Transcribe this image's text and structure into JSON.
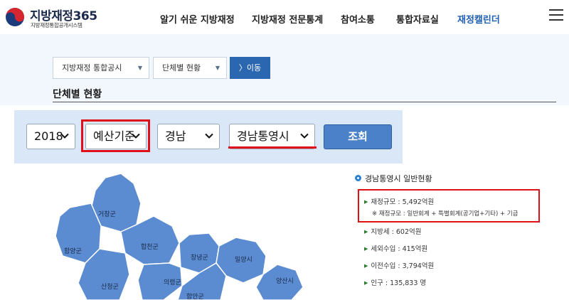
{
  "header": {
    "logo_title": "지방재정365",
    "logo_subtitle": "지방재정통합공개시스템",
    "nav": [
      {
        "label": "알기 쉬운 지방재정",
        "active": false
      },
      {
        "label": "지방재정 전문통계",
        "active": false
      },
      {
        "label": "참여소통",
        "active": false
      },
      {
        "label": "통합자료실",
        "active": false
      },
      {
        "label": "재정캘린더",
        "active": true
      }
    ]
  },
  "breadcrumb": {
    "level1": "지방재정 통합공시",
    "level2": "단체별 현황",
    "go_label": "〉이동"
  },
  "section_title": "단체별 현황",
  "filters": {
    "year": "2018",
    "basis": "예산기준",
    "region": "경남",
    "municipality": "경남통영시",
    "search_label": "조회"
  },
  "map": {
    "regions": [
      "거창군",
      "함양군",
      "합천군",
      "창녕군",
      "밀양시",
      "양산시",
      "산청군",
      "의령군",
      "함안군"
    ]
  },
  "info": {
    "title": "경남통영시 일반현황",
    "fiscal_scale": "재정규모 : 5,492억원",
    "fiscal_note": "※ 재정규모 : 일반회계 + 특별회계(공기업+기타) + 기금",
    "local_tax": "지방세 : 602억원",
    "non_tax": "세외수입 : 415억원",
    "transfer": "이전수입 : 3,794억원",
    "population": "인구 : 135,833 명"
  },
  "colors": {
    "accent": "#2b66b0",
    "map_fill": "#5b8bd0",
    "highlight_red": "#e0101a"
  }
}
